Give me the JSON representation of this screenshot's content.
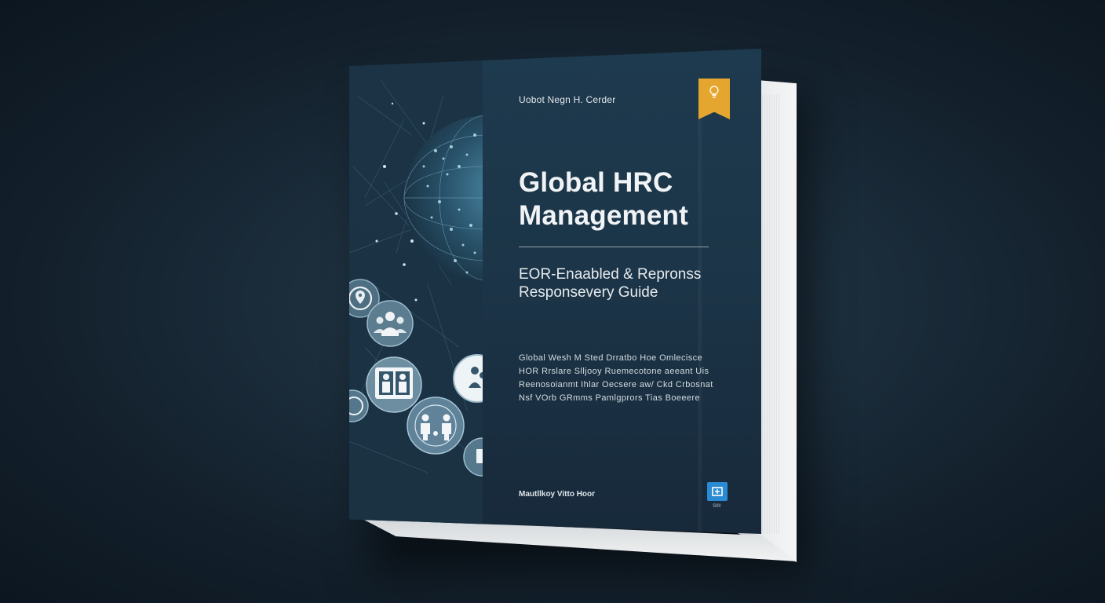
{
  "book": {
    "author": "Uobot Negn H. Cerder",
    "title_lines": [
      "Global HRC",
      "Management"
    ],
    "subtitle_lines": [
      "EOR-Enaabled & Repronss",
      "Responsevery Guide"
    ],
    "blurb_lines": [
      "Global Wesh M Sted Drratbo Hoe Omlecisce",
      "HOR Rrslare Slljooy Ruemecotone aeeant Uis",
      "Reenosoianmt Ihlar Oecsere aw/ Ckd Crbosnat",
      "Nsf VOrb GRmms Pamlgprors Tias Boeeere"
    ],
    "publisher": "Mautllkoy Vitto Hoor",
    "publisher_small": "S0ll"
  },
  "colors": {
    "background": "#15232f",
    "cover": "#1c3548",
    "bookmark": "#e5a62f",
    "publisher_logo": "#2a8bd3"
  },
  "icons": [
    "globe-network-icon",
    "location-pin-icon",
    "team-icon",
    "people-frame-icon",
    "family-icon",
    "person-icon",
    "lightbulb-icon"
  ]
}
